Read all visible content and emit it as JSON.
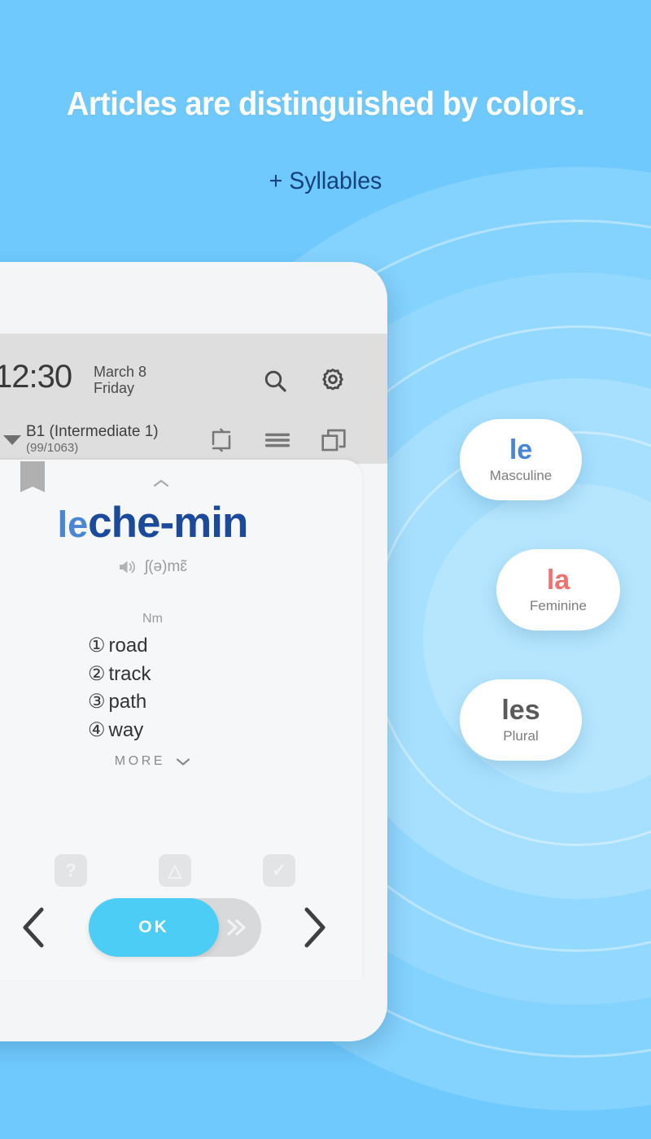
{
  "promo": {
    "headline": "Articles are distinguished by colors.",
    "subhead": "+ Syllables",
    "background_color": "#6fc9fd",
    "subhead_color": "#14427e"
  },
  "phone": {
    "status_bar": {
      "time": "12:30",
      "date": "March 8",
      "weekday": "Friday",
      "search_icon": "search-icon",
      "settings_icon": "gear-icon"
    },
    "level_bar": {
      "expand_icon": "caret-down-icon",
      "level": "B1 (Intermediate 1)",
      "progress": "(99/1063)",
      "repeat_icon": "repeat-icon",
      "menu_icon": "hamburger-menu-icon",
      "stack_icon": "stacked-cards-icon"
    },
    "word_card": {
      "bookmark_icon": "bookmark-icon",
      "collapse_icon": "chevron-up-icon",
      "article": "le",
      "article_color": "#4a86d8",
      "word": "che-min",
      "word_color": "#1b4a9c",
      "speaker_icon": "speaker-icon",
      "ipa": "ʃ(ə)mɛ̃",
      "part_of_speech": "Nm",
      "definitions": [
        {
          "num": "①",
          "text": "road"
        },
        {
          "num": "②",
          "text": "track"
        },
        {
          "num": "③",
          "text": "path"
        },
        {
          "num": "④",
          "text": "way"
        }
      ],
      "more_label": "MORE",
      "more_icon": "chevron-down-icon"
    },
    "actions": {
      "hint_button": "?",
      "warn_button": "△",
      "done_button": "✓",
      "prev_icon": "chevron-left-icon",
      "next_icon": "chevron-right-icon",
      "ok_label": "OK",
      "ok_color": "#4ccdf5",
      "skip_icon": "double-chevron-right-icon"
    }
  },
  "article_cards": [
    {
      "word": "le",
      "label": "Masculine",
      "color": "#4a86d8"
    },
    {
      "word": "la",
      "label": "Feminine",
      "color": "#f4706e"
    },
    {
      "word": "les",
      "label": "Plural",
      "color": "#5a5a5a"
    }
  ]
}
